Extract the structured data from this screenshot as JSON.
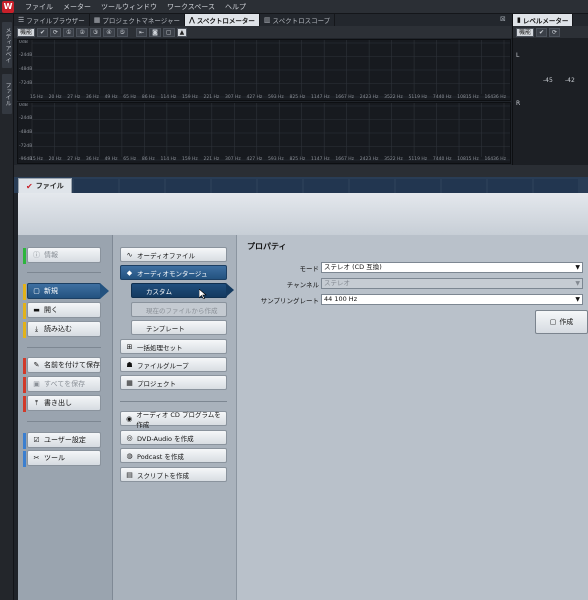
{
  "menubar": {
    "items": [
      "ファイル",
      "メーター",
      "ツールウィンドウ",
      "ワークスペース",
      "ヘルプ"
    ]
  },
  "left_strip": {
    "tabs": [
      "メディアベイ",
      "ファイル"
    ]
  },
  "top_tabs": {
    "items": [
      {
        "label": "ファイルブラウザー",
        "icon": "menu-icon"
      },
      {
        "label": "プロジェクトマネージャー",
        "icon": "grid-icon"
      },
      {
        "label": "スペクトロメーター",
        "icon": "spectrum-icon",
        "active": true
      },
      {
        "label": "スペクトロスコープ",
        "icon": "bars-icon"
      }
    ],
    "close": "⊠"
  },
  "spectro": {
    "toolbar_label": "機能",
    "freq_labels": [
      "15 Hz",
      "20 Hz",
      "27 Hz",
      "36 Hz",
      "49 Hz",
      "65 Hz",
      "86 Hz",
      "114 Hz",
      "159 Hz",
      "221 Hz",
      "307 Hz",
      "427 Hz",
      "593 Hz",
      "825 Hz",
      "1147 Hz",
      "1667 Hz",
      "2423 Hz",
      "3522 Hz",
      "5119 Hz",
      "7440 Hz",
      "10815 Hz",
      "16436 Hz"
    ],
    "db_labels": [
      "0dB",
      "-24dB",
      "-48dB",
      "-72dB",
      "-96dB"
    ]
  },
  "level": {
    "tab": "レベルメーター",
    "toolbar_label": "機能",
    "left": "L",
    "right": "R",
    "val1": "-45",
    "val2": "-42"
  },
  "file_tab": {
    "label": "ファイル"
  },
  "left_menu": {
    "info": "情報",
    "new": "新規",
    "open": "開く",
    "import": "読み込む",
    "save_as": "名前を付けて保存",
    "save_all": "すべてを保存",
    "export": "書き出し",
    "user_settings": "ユーザー設定",
    "tools": "ツール"
  },
  "mid_menu": {
    "audio_file": "オーディオファイル",
    "audio_montage": "オーディオモンタージュ",
    "custom": "カスタム",
    "from_current": "現在のファイルから作成",
    "template": "テンプレート",
    "batch": "一括処理セット",
    "file_group": "ファイルグループ",
    "project": "プロジェクト",
    "cd_program": "オーディオ CD プログラムを作成",
    "dvd_audio": "DVD-Audio を作成",
    "podcast": "Podcast を作成",
    "script": "スクリプトを作成"
  },
  "properties": {
    "title": "プロパティ",
    "mode_label": "モード",
    "mode_value": "ステレオ (CD 互換)",
    "channel_label": "チャンネル",
    "channel_value": "ステレオ",
    "samplerate_label": "サンプリングレート",
    "samplerate_value": "44 100 Hz",
    "create_label": "作成"
  },
  "colors": {
    "accent_blue": "#23527f",
    "green": "#2db53d",
    "yellow": "#e2b21a",
    "red": "#d13a2a",
    "blue": "#3b7fd0"
  }
}
